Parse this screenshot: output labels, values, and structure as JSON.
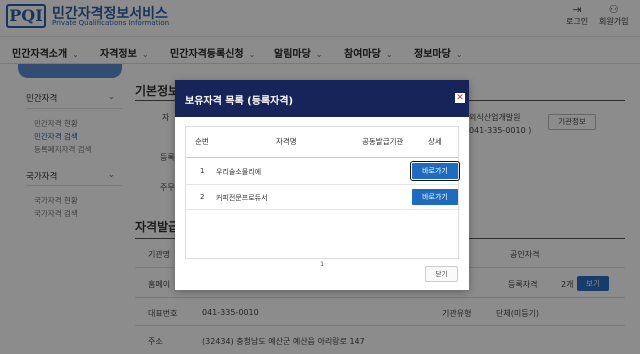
{
  "header": {
    "logo_text": "PQI",
    "title": "민간자격정보서비스",
    "subtitle": "Private Qualifications Information",
    "login_label": "로그인",
    "signup_label": "회원가입"
  },
  "nav": {
    "items": [
      {
        "label": "민간자격소개"
      },
      {
        "label": "자격정보"
      },
      {
        "label": "민간자격등록신청"
      },
      {
        "label": "알림마당"
      },
      {
        "label": "참여마당"
      },
      {
        "label": "정보마당"
      }
    ]
  },
  "sidebar": {
    "group1": {
      "label": "민간자격",
      "items": [
        "민간자격 현황",
        "민간자격 검색",
        "등록폐지자격 검색"
      ]
    },
    "group2": {
      "label": "국가자격",
      "items": [
        "국가자격 현황",
        "국가자격 검색"
      ]
    }
  },
  "background": {
    "section1_title": "기본정보",
    "section2_title": "자격발급",
    "org_name_partial": "외식산업개발원",
    "phone_partial": "041-335-0010 )",
    "org_info_btn": "기관정보",
    "row_label_reg": "등록",
    "row_label_addr": "주무",
    "label_org": "기관명",
    "label_public": "공인자격",
    "label_home": "홈페이",
    "label_reg_quals": "등록자격",
    "reg_count": "2개",
    "view_btn": "보기",
    "label_rep": "대표번호",
    "rep_number": "041-335-0010",
    "label_type": "기관유형",
    "type_value": "단체(미등기)",
    "label_addr": "주소",
    "addr_value": "(32434) 충청남도 예산군 예산읍 아리랑로 147"
  },
  "modal": {
    "title": "보유자격 목록 (등록자격)",
    "close_icon": "close-icon",
    "columns": [
      "순번",
      "자격명",
      "공동발급기관",
      "상세"
    ],
    "rows": [
      {
        "no": "1",
        "name": "우리술소믈리에",
        "co_org": "",
        "action": "바로가기"
      },
      {
        "no": "2",
        "name": "커피전문프로듀서",
        "co_org": "",
        "action": "바로가기"
      }
    ],
    "page": "1",
    "close_label": "닫기"
  },
  "colors": {
    "brand": "#2d5fa6",
    "modal_header": "#16245a",
    "primary_button": "#1e6bc0"
  }
}
